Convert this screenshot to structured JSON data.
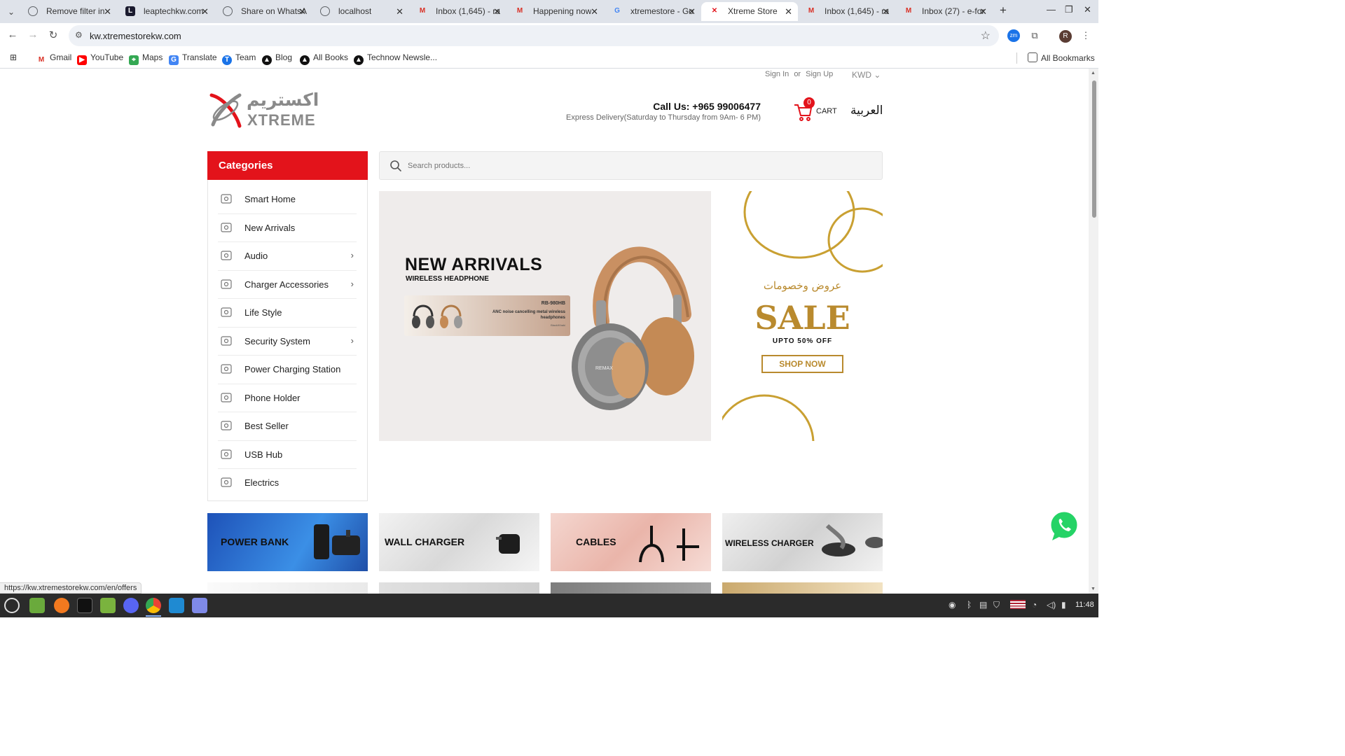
{
  "browser": {
    "tabs": [
      {
        "title": "Remove filter in",
        "favicon": "globe-icon",
        "color": "#5f6368"
      },
      {
        "title": "leaptechkw.com",
        "favicon": "leaptech-icon",
        "color": "#1a1a2e"
      },
      {
        "title": "Share on WhatsA",
        "favicon": "globe-icon",
        "color": "#5f6368"
      },
      {
        "title": "localhost",
        "favicon": "globe-icon",
        "color": "#5f6368"
      },
      {
        "title": "Inbox (1,645) - ra",
        "favicon": "gmail-icon",
        "color": "#d93025"
      },
      {
        "title": "Happening now",
        "favicon": "gmail-icon",
        "color": "#d93025"
      },
      {
        "title": "xtremestore - Go",
        "favicon": "google-icon",
        "color": "#4285f4"
      },
      {
        "title": "Xtreme Store",
        "favicon": "xtreme-icon",
        "color": "#e3131b"
      },
      {
        "title": "Inbox (1,645) - ra",
        "favicon": "gmail-icon",
        "color": "#d93025"
      },
      {
        "title": "Inbox (27) - e-for",
        "favicon": "gmail-icon",
        "color": "#d93025"
      }
    ],
    "active_tab": 7,
    "url": "kw.xtremestorekw.com",
    "profile_initial": "R",
    "bookmarks": [
      {
        "label": "Gmail",
        "icon": "gmail-icon",
        "color": "#d93025"
      },
      {
        "label": "YouTube",
        "icon": "youtube-icon",
        "color": "#ff0000"
      },
      {
        "label": "Maps",
        "icon": "maps-icon",
        "color": "#34a853"
      },
      {
        "label": "Translate",
        "icon": "translate-icon",
        "color": "#4285f4"
      },
      {
        "label": "Team",
        "icon": "team-icon",
        "color": "#1a73e8"
      },
      {
        "label": "Blog",
        "icon": "blog-icon",
        "color": "#111111"
      },
      {
        "label": "All Books",
        "icon": "books-icon",
        "color": "#111111"
      },
      {
        "label": "Technow Newsle...",
        "icon": "technow-icon",
        "color": "#111111"
      }
    ],
    "all_bookmarks_label": "All Bookmarks",
    "status_url": "https://kw.xtremestorekw.com/en/offers"
  },
  "site": {
    "sign_in": "Sign In",
    "or": "or",
    "sign_up": "Sign Up",
    "currency": "KWD",
    "logo_ar": "اكستريم",
    "logo_en": "XTREME",
    "call_us": "Call Us: +965 99006477",
    "delivery": "Express Delivery(Saturday to Thursday from 9Am- 6 PM)",
    "cart_count": "0",
    "cart_label": "CART",
    "language": "العربية",
    "brand_color": "#e3131b",
    "categories_title": "Categories",
    "categories": [
      {
        "label": "Smart Home",
        "icon": "smart-home-icon",
        "has_sub": false
      },
      {
        "label": "New Arrivals",
        "icon": "new-arrivals-icon",
        "has_sub": false
      },
      {
        "label": "Audio",
        "icon": "audio-icon",
        "has_sub": true
      },
      {
        "label": "Charger Accessories",
        "icon": "charger-icon",
        "has_sub": true
      },
      {
        "label": "Life Style",
        "icon": "lifestyle-icon",
        "has_sub": false
      },
      {
        "label": "Security System",
        "icon": "security-icon",
        "has_sub": true
      },
      {
        "label": "Power Charging Station",
        "icon": "power-station-icon",
        "has_sub": false
      },
      {
        "label": "Phone Holder",
        "icon": "phone-holder-icon",
        "has_sub": false
      },
      {
        "label": "Best Seller",
        "icon": "best-seller-icon",
        "has_sub": false
      },
      {
        "label": "USB Hub",
        "icon": "usb-hub-icon",
        "has_sub": false
      },
      {
        "label": "Electrics",
        "icon": "electrics-icon",
        "has_sub": false
      }
    ],
    "search_placeholder": "Search products...",
    "hero": {
      "title": "NEW ARRIVALS",
      "subtitle": "WIRELESS HEADPHONE",
      "model": "RB-980HB",
      "description": "ANC noise cancelling metal wireless headphones",
      "color": "Black/Khaki",
      "brand_on_product": "REMAX"
    },
    "sale": {
      "arabic": "عروض وخصومات",
      "title": "SALE",
      "upto": "UPTO 50% OFF",
      "cta": "SHOP NOW",
      "gold": "#b98a2e"
    },
    "tiles": [
      {
        "label": "POWER BANK",
        "bg": "#2f6fd6"
      },
      {
        "label": "WALL CHARGER",
        "bg": "#ededed"
      },
      {
        "label": "CABLES",
        "bg": "#f1c9c0"
      },
      {
        "label": "WIRELESS CHARGER",
        "bg": "#e6e6e6"
      }
    ]
  },
  "taskbar": {
    "time": "11:48"
  }
}
